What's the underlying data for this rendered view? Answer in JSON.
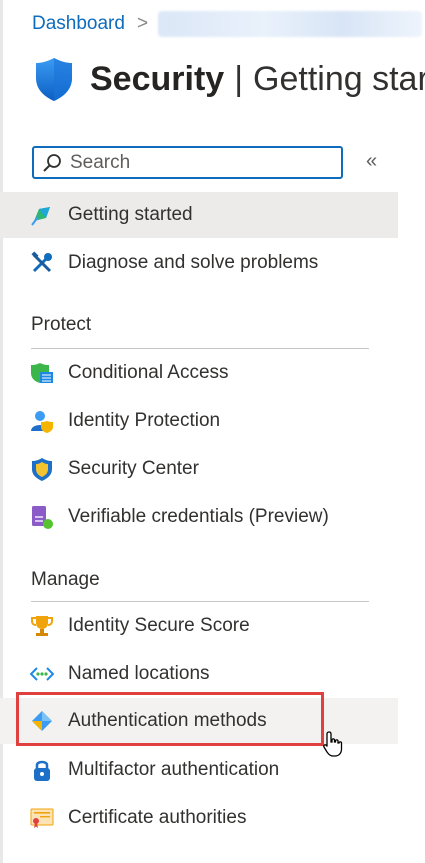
{
  "breadcrumb": {
    "root": "Dashboard",
    "separator": ">"
  },
  "page": {
    "title_bold": "Security",
    "title_sep": "|",
    "title_rest": "Getting star"
  },
  "search": {
    "placeholder": "Search"
  },
  "collapse_glyph": "«",
  "nav": {
    "getting_started": "Getting started",
    "diagnose": "Diagnose and solve problems"
  },
  "sections": {
    "protect": {
      "label": "Protect",
      "items": [
        "Conditional Access",
        "Identity Protection",
        "Security Center",
        "Verifiable credentials (Preview)"
      ]
    },
    "manage": {
      "label": "Manage",
      "items": [
        "Identity Secure Score",
        "Named locations",
        "Authentication methods",
        "Multifactor authentication",
        "Certificate authorities"
      ]
    }
  },
  "colors": {
    "link": "#0f6cbd",
    "highlight_border": "#e0413f",
    "selected_bg": "#edebe9"
  }
}
